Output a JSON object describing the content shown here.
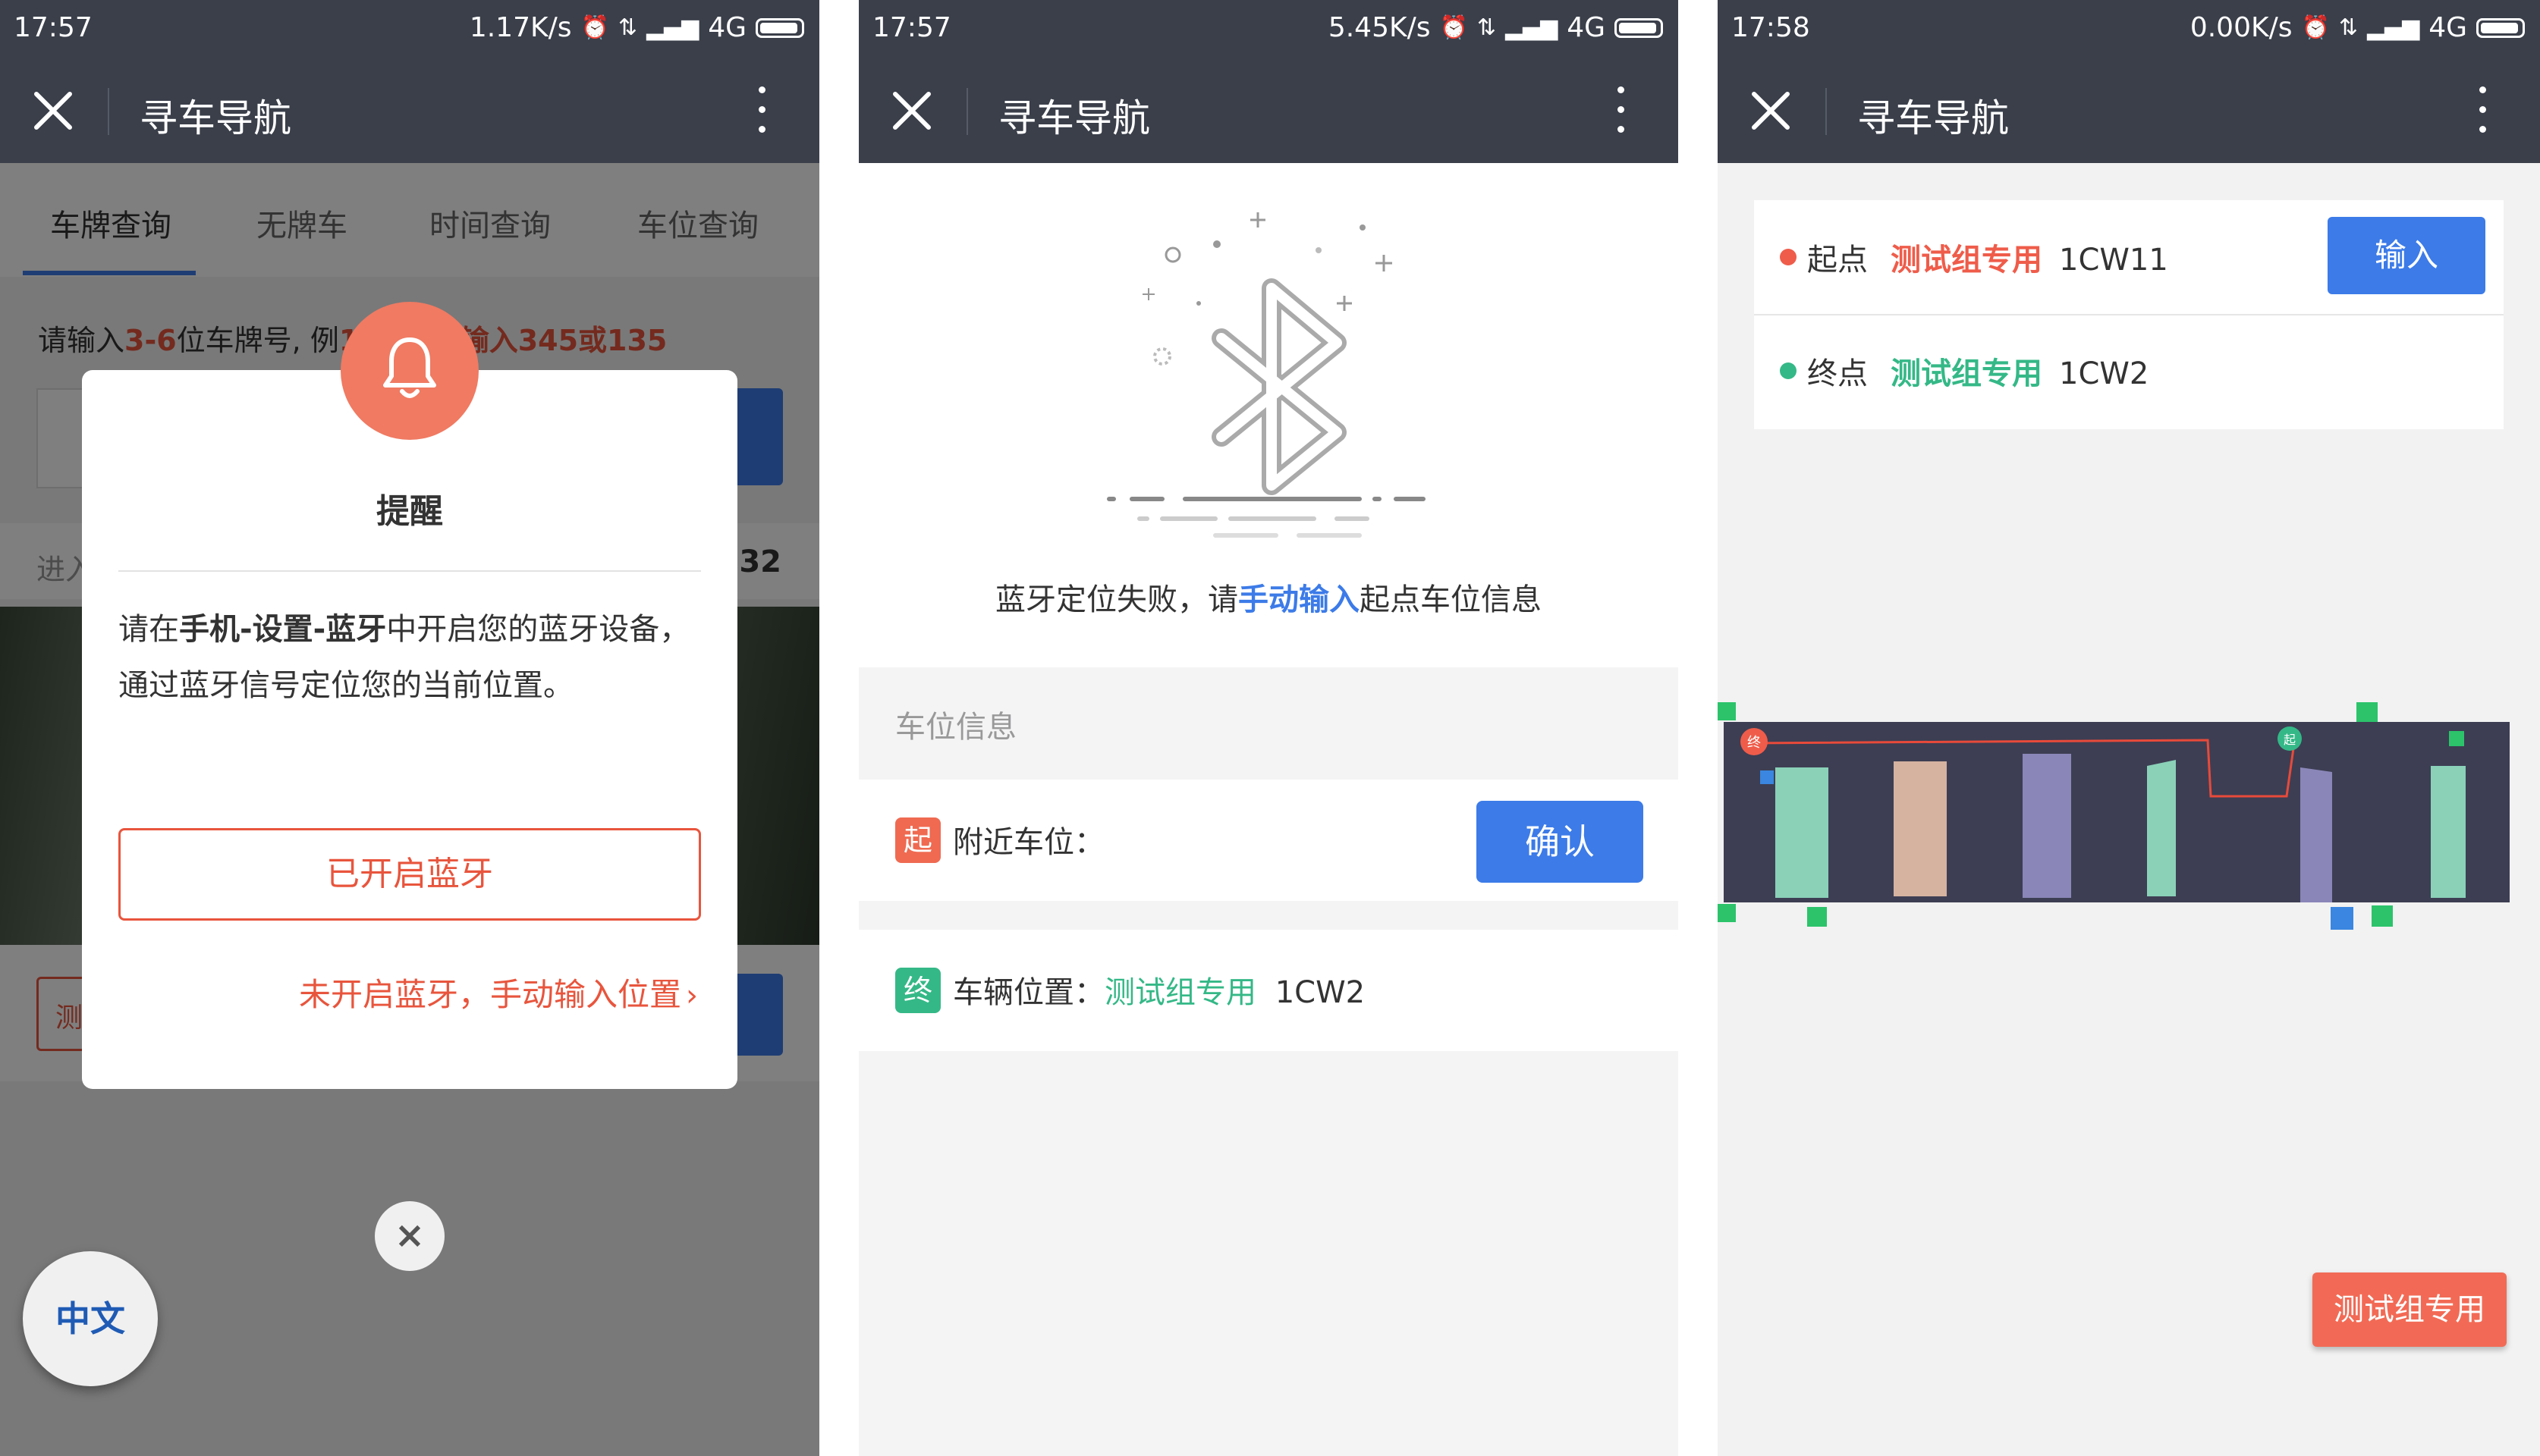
{
  "screens": [
    {
      "status": {
        "time": "17:57",
        "speed": "1.17K/s",
        "network": "4G"
      },
      "title": "寻车导航",
      "tabs": [
        "车牌查询",
        "无牌车",
        "时间查询",
        "车位查询"
      ],
      "hint": {
        "prefix": "请输入",
        "range": "3-6",
        "middle": "位车牌号, 例",
        "example": "12345, 输入345或135"
      },
      "info": {
        "left": "进入",
        "right": "32"
      },
      "bottom_tag": "测",
      "dialog": {
        "title": "提醒",
        "body_prefix": "请在",
        "body_bold": "手机-设置-蓝牙",
        "body_suffix": "中开启您的蓝牙设备，通过蓝牙信号定位您的当前位置。",
        "primary_button": "已开启蓝牙",
        "secondary_link": "未开启蓝牙，手动输入位置",
        "close": "×"
      },
      "lang_button": "中文"
    },
    {
      "status": {
        "time": "17:57",
        "speed": "5.45K/s",
        "network": "4G"
      },
      "title": "寻车导航",
      "message": {
        "prefix": "蓝牙定位失败，请",
        "highlight": "手动输入",
        "suffix": "起点车位信息"
      },
      "input_placeholder": "车位信息",
      "nearby": {
        "badge": "起",
        "label": "附近车位：",
        "button": "确认"
      },
      "vehicle": {
        "badge": "终",
        "label": "车辆位置：",
        "tag": "测试组专用",
        "code": "1CW2"
      }
    },
    {
      "status": {
        "time": "17:58",
        "speed": "0.00K/s",
        "network": "4G"
      },
      "title": "寻车导航",
      "start": {
        "label": "起点",
        "tag": "测试组专用",
        "code": "1CW11",
        "button": "输入"
      },
      "end": {
        "label": "终点",
        "tag": "测试组专用",
        "code": "1CW2"
      },
      "map": {
        "start_marker": "起",
        "end_marker": "终"
      },
      "dest_button": "测试组专用"
    }
  ],
  "colors": {
    "accent": "#3c7be8",
    "header": "#3a3f4a",
    "warn": "#ef5c4a",
    "green": "#34b887"
  }
}
